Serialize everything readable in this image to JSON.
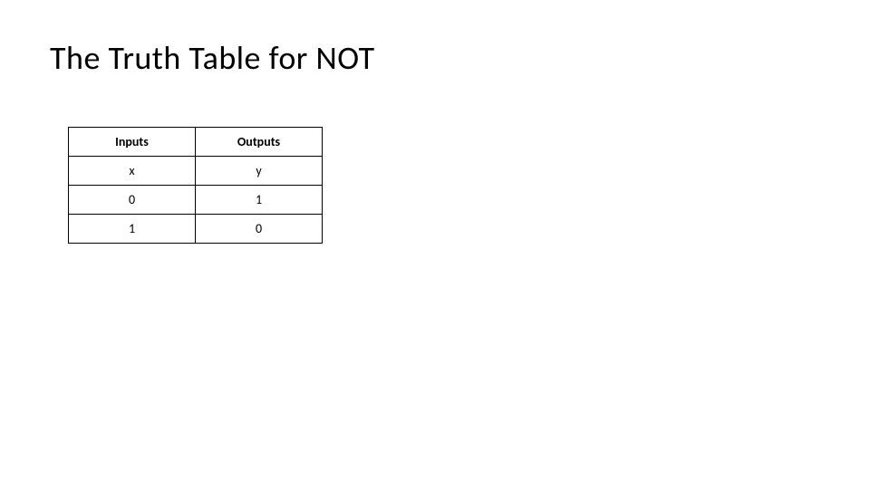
{
  "title": "The Truth Table for NOT",
  "chart_data": {
    "type": "table",
    "headers": [
      "Inputs",
      "Outputs"
    ],
    "subheaders": [
      "x",
      "y"
    ],
    "rows": [
      [
        "0",
        "1"
      ],
      [
        "1",
        "0"
      ]
    ]
  }
}
